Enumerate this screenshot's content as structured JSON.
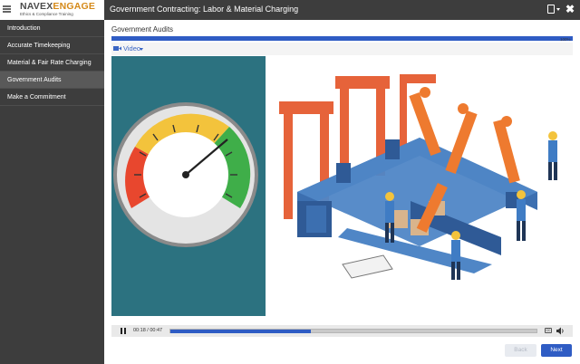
{
  "brand": {
    "logo_navex": "NAVEX",
    "logo_engage": "ENGAGE",
    "logo_tagline": "Ethics & Compliance Training"
  },
  "header": {
    "course_title": "Government Contracting: Labor & Material Charging"
  },
  "sidebar": {
    "items": [
      {
        "label": "Introduction",
        "active": false
      },
      {
        "label": "Accurate Timekeeping",
        "active": false
      },
      {
        "label": "Material & Fair Rate Charging",
        "active": false
      },
      {
        "label": "Government Audits",
        "active": true
      },
      {
        "label": "Make a Commitment",
        "active": false
      }
    ]
  },
  "main": {
    "section_title": "Government Audits",
    "progress_percent": 100,
    "progress_label": "100%",
    "media_label": "Video"
  },
  "player": {
    "time": "00:18 / 00:47",
    "played_fraction": 0.383
  },
  "nav": {
    "back_label": "Back",
    "next_label": "Next"
  },
  "colors": {
    "accent": "#2f5cc4",
    "sidebar_bg": "#3d3d3d",
    "teal_panel": "#2c7280",
    "brand_orange": "#d58a1a"
  },
  "icons": [
    "menu-icon",
    "document-icon",
    "close-icon",
    "video-camera-icon",
    "pause-icon",
    "closed-captions-icon",
    "volume-icon"
  ]
}
